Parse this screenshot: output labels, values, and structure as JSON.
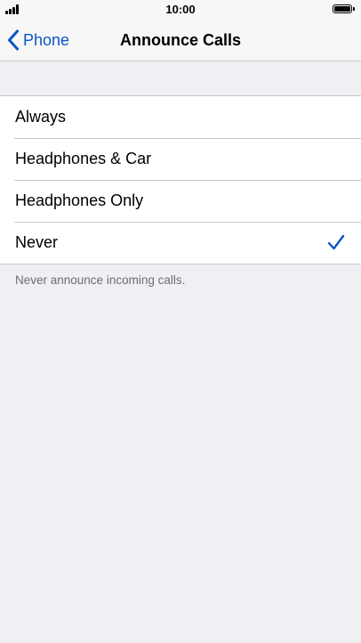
{
  "status_bar": {
    "time": "10:00",
    "signal_icon": "signal-bars-icon",
    "battery_icon": "battery-icon"
  },
  "nav": {
    "back_label": "Phone",
    "back_icon": "chevron-left-icon",
    "title": "Announce Calls",
    "accent_color": "#0a56c7"
  },
  "options": [
    {
      "label": "Always",
      "selected": false
    },
    {
      "label": "Headphones & Car",
      "selected": false
    },
    {
      "label": "Headphones Only",
      "selected": false
    },
    {
      "label": "Never",
      "selected": true
    }
  ],
  "selected_icon": "checkmark-icon",
  "footer": "Never announce incoming calls."
}
